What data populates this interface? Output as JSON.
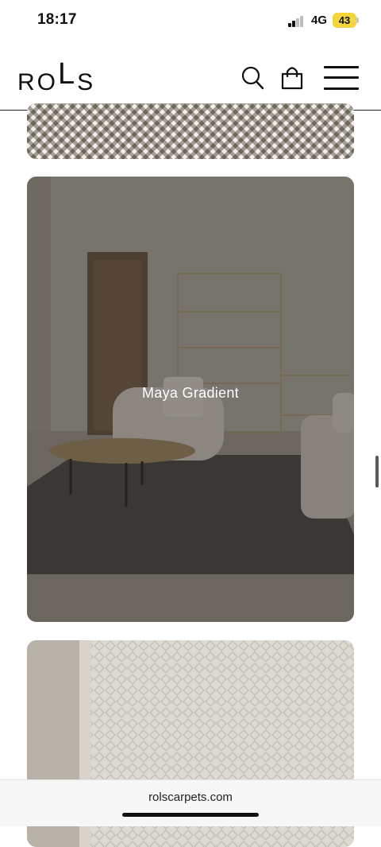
{
  "status_bar": {
    "time": "18:17",
    "network": "4G",
    "battery": "43",
    "battery_color": "#f2d43b"
  },
  "header": {
    "logo_text": "ROLS",
    "search_icon": "search-icon",
    "bag_icon": "shopping-bag-icon",
    "menu_icon": "hamburger-menu-icon"
  },
  "products": [
    {
      "title": "",
      "image": "diamond-pattern-rug-closeup"
    },
    {
      "title": "Maya Gradient",
      "image": "living-room-dark-rug"
    },
    {
      "title": "",
      "image": "light-diamond-rug-closeup"
    }
  ],
  "browser": {
    "url": "rolscarpets.com"
  }
}
